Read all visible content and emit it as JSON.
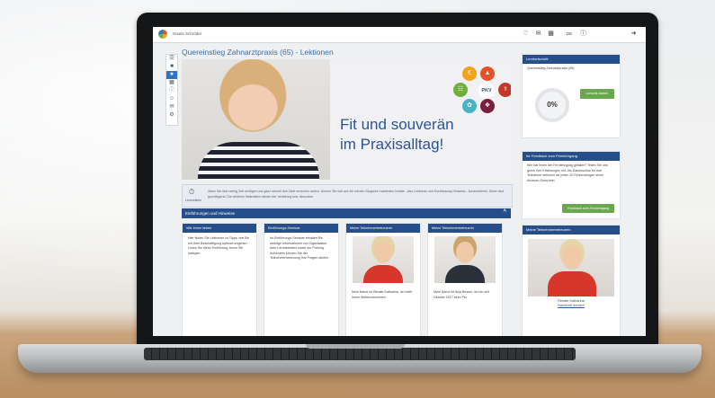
{
  "app": {
    "user_name": "Gisela Schröder",
    "language": "DE",
    "page_title": "Quereinstieg Zahnarztpraxis (65) - Lektionen"
  },
  "banner": {
    "headline_line1": "Fit und souverän",
    "headline_line2": "im Praxisalltag!",
    "badge": "PKV"
  },
  "notice": {
    "label": "Lernzeitinfo",
    "text": "Wann Sie über wenig Zeit verfügen und ganz schnell Ihre Ziele erreichen wollen, können Sie sich auf die mit den Stoppuhr markierten Inhalte - also Lektionen und Kurzfassung Hinweise - konzentrieren. Diese sind grundlegend. Die weiteren Materialien dienen der Vertiefung bzw. Abrunden."
  },
  "section": {
    "title": "Einführungen und Hinweise",
    "collapse": "^"
  },
  "cards": [
    {
      "title": "Wie Ihnen lieben",
      "text": "Hier finden Sie Lektionen zu Tipps, wie Sie mit Ihrer Beschäftigung optimal umgehen. Lesen Sie diese Einführung, bevor Sie loslegen."
    },
    {
      "title": "Einführungs-Seminar",
      "text": "Im Einführungs-Seminar erhalten Sie wichtige Informationen zur Organisation Ihrer Lerneinheiten sowie zur Prüfung. Außerdem können Sie der Teilnehmerbetreuung Ihre Fragen stellen."
    },
    {
      "title": "Meine Teilnehmerbetreuerin",
      "caption": "Mein Name ist Renate Katharina, ich helfe Ihnen Weiterzukommen"
    },
    {
      "title": "Meine Teilnehmerbetreuerin",
      "caption": "Mein Name ist Anja Besser, ich bin seit Oktober 2017 beim Pro"
    }
  ],
  "right": {
    "progress_title": "Lernfortschritt",
    "progress_course": "Quereinstieg Zahnarztpraxis (65)",
    "progress_button": "Lernzeit starten",
    "progress_value": "0%",
    "feedback_title": "Ihr Feedback zum Fernlehrgang",
    "feedback_text": "Wie hat Ihnen der Fernlehrgang gefallen? Teilen Sie uns gerne Ihre Erfahrungen mit. Als Dankeschön für Ihre Teilnahme verlosen wir jeden 20 Einsendungen einen Amazon-Gutschein.",
    "feedback_button": "Feedback zum Fernlehrgang",
    "advisor_title": "Meine Teilnehmerbetreuerin",
    "advisor_name": "Renate Katharina",
    "advisor_link": "Nachricht senden"
  }
}
